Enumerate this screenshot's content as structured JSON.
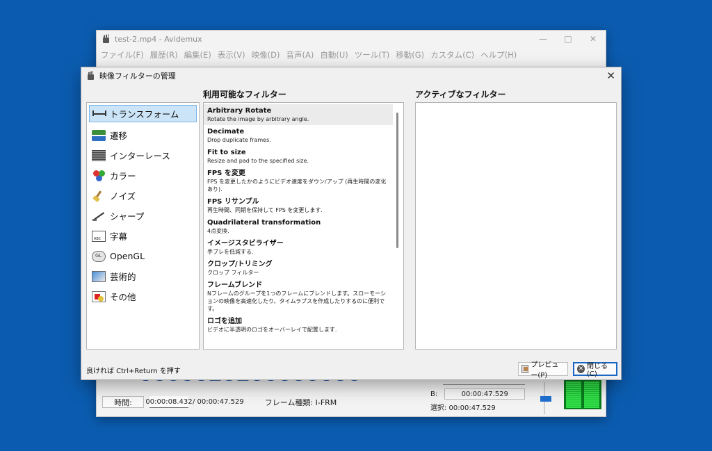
{
  "main_window": {
    "title": "test-2.mp4 - Avidemux",
    "menu": [
      "ファイル(F)",
      "履歴(R)",
      "編集(E)",
      "表示(V)",
      "映像(D)",
      "音声(A)",
      "自動(U)",
      "ツール(T)",
      "移動(G)",
      "カスタム(C)",
      "ヘルプ(H)"
    ],
    "time_label": "時間:",
    "current_time": "00:00:08.432",
    "total_time": "/ 00:00:47.529",
    "frame_type": "フレーム種類: I-FRM",
    "b_label": "B:",
    "b_value": "00:00:47.529",
    "selection": "選択: 00:00:47.529"
  },
  "dialog": {
    "title": "映像フィルターの管理",
    "available_header": "利用可能なフィルター",
    "active_header": "アクティブなフィルター",
    "categories": [
      {
        "label": "トランスフォーム",
        "icon": "transform-icon"
      },
      {
        "label": "遷移",
        "icon": "transition-icon"
      },
      {
        "label": "インターレース",
        "icon": "interlace-icon"
      },
      {
        "label": "カラー",
        "icon": "color-icon"
      },
      {
        "label": "ノイズ",
        "icon": "noise-icon"
      },
      {
        "label": "シャープ",
        "icon": "sharpen-icon"
      },
      {
        "label": "字幕",
        "icon": "subtitle-icon"
      },
      {
        "label": "OpenGL",
        "icon": "opengl-icon"
      },
      {
        "label": "芸術的",
        "icon": "artistic-icon"
      },
      {
        "label": "その他",
        "icon": "misc-icon"
      }
    ],
    "filters": [
      {
        "name": "Arbitrary Rotate",
        "desc": "Rotate the image by arbitrary angle."
      },
      {
        "name": "Decimate",
        "desc": "Drop duplicate frames."
      },
      {
        "name": "Fit to size",
        "desc": "Resize and pad to the specified size."
      },
      {
        "name": "FPS を変更",
        "desc": "FPS を変更したかのようにビデオ速度をダウン/アップ (再生時間の変化あり)."
      },
      {
        "name": "FPS リサンプル",
        "desc": "再生時間、同期を保持して FPS を変更します."
      },
      {
        "name": "Quadrilateral transformation",
        "desc": "4点変換."
      },
      {
        "name": "イメージスタビライザー",
        "desc": "手ブレを低減する."
      },
      {
        "name": "クロップ/トリミング",
        "desc": "クロップ フィルター"
      },
      {
        "name": "フレームブレンド",
        "desc": "Nフレームのグループを1つのフレームにブレンドします。スローモーションの映像を高速化したり、タイムラプスを作成したりするのに便利です。"
      },
      {
        "name": "ロゴを追加",
        "desc": "ビデオに半透明のロゴをオーバーレイで配置します."
      }
    ],
    "hint": "良ければ Ctrl+Return を押す",
    "preview_button": "プレビュー(P)",
    "close_button": "閉じる(C)"
  },
  "colors": {
    "desktop": "#0b5cb0",
    "selection": "#cce4f7",
    "accent": "#1a66c4"
  }
}
